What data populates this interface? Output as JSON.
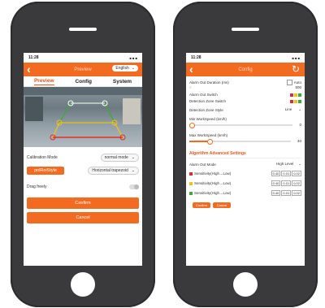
{
  "left_phone": {
    "status_time": "11:28",
    "status_icons": "■ ■ ■",
    "nav_title": "Preview",
    "language": {
      "value": "English",
      "chevron": "⌄"
    },
    "tabs": [
      {
        "label": "Preview",
        "active": true
      },
      {
        "label": "Config",
        "active": false
      },
      {
        "label": "System",
        "active": false
      }
    ],
    "calibration_mode": {
      "label": "Calibration Mode",
      "value": "normal mode"
    },
    "style_button": "polRoiStyle",
    "shape_select": "Horizontal trapezoid",
    "drag_freely": {
      "label": "Drag freely",
      "on": false
    },
    "confirm_label": "Confirm",
    "cancel_label": "Cancel"
  },
  "right_phone": {
    "status_time": "11:28",
    "nav_title": "Config",
    "alarm_out_duration": {
      "label": "Alarm Out Duration (ms)",
      "auto_label": "Auto",
      "value": "500"
    },
    "alarm_out_switch": "Alarm Out Switch",
    "detection_zone_switch": "Detection Zone Switch",
    "detection_zone_style": {
      "label": "Detection Zone Style",
      "value": "Line"
    },
    "min_speed": {
      "label": "Min WorkSpeed (km/h)",
      "value": "0",
      "level": 0.02
    },
    "max_speed": {
      "label": "Max WorkSpeed (km/h)",
      "value": "40",
      "level": 0.2
    },
    "advanced_title": "Algorithm Advanced Settings",
    "alarm_out_mode": {
      "label": "Alarm Out Mode",
      "value": "High Level"
    },
    "sensitivity_rows": [
      {
        "color": "#d9302b",
        "label": "Sensitivity(High→Low)",
        "values": [
          "0.40",
          "0.01",
          "0.02"
        ]
      },
      {
        "color": "#f1c21b",
        "label": "Sensitivity(High→Low)",
        "values": [
          "0.40",
          "0.01",
          "0.02"
        ]
      },
      {
        "color": "#3aa83a",
        "label": "Sensitivity(High→Low)",
        "values": [
          "0.40",
          "0.01",
          "0.02"
        ]
      }
    ],
    "confirm_label": "Confirm",
    "cancel_label": "Cancel"
  },
  "colors": {
    "accent": "#f26b21",
    "phone": "#3a3a3c",
    "red": "#d9302b",
    "yellow": "#f1c21b",
    "green": "#3aa83a"
  }
}
